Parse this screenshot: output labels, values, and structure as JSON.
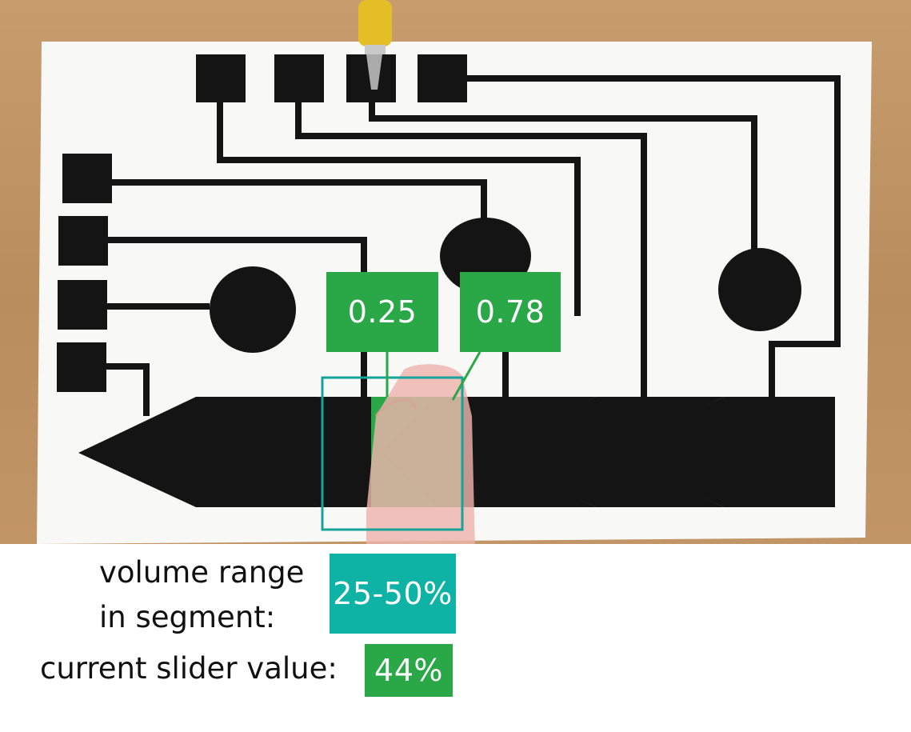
{
  "threshold_labels": {
    "low": "0.25",
    "high": "0.78"
  },
  "segment_readout": {
    "caption_line1": "volume range",
    "caption_line2": "in segment:",
    "value": "25-50%"
  },
  "slider_readout": {
    "caption": "current slider value:",
    "value": "44%"
  },
  "colors": {
    "green_highlight": "#2aa847",
    "teal_highlight": "#0fb3a6",
    "ink": "#111111",
    "paper": "#ffffff"
  },
  "icons": {
    "pointer": "yellow-alligator-clip",
    "finger": "fingertip-touch"
  }
}
